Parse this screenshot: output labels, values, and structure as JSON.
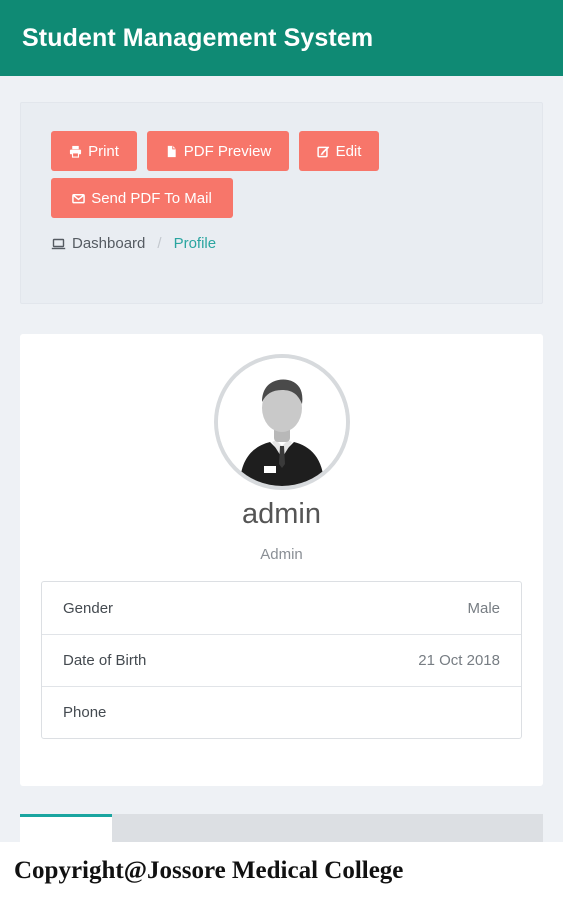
{
  "header": {
    "title": "Student Management System"
  },
  "toolbar": {
    "print_label": "Print",
    "pdf_preview_label": "PDF Preview",
    "edit_label": "Edit",
    "send_mail_label": "Send PDF To Mail"
  },
  "breadcrumb": {
    "home_label": "Dashboard",
    "separator": "/",
    "current_label": "Profile"
  },
  "profile": {
    "name": "admin",
    "role": "Admin",
    "details": [
      {
        "label": "Gender",
        "value": "Male"
      },
      {
        "label": "Date of Birth",
        "value": "21 Oct 2018"
      },
      {
        "label": "Phone",
        "value": ""
      }
    ]
  },
  "footer": {
    "copyright": "Copyright@Jossore Medical College"
  },
  "colors": {
    "header_bg": "#0f8a74",
    "button_bg": "#f7766a",
    "breadcrumb_active": "#2aa5a0",
    "page_bg": "#eef1f5"
  },
  "icons": {
    "print": "print-icon",
    "pdf": "file-icon",
    "edit": "edit-icon",
    "mail": "envelope-icon",
    "dashboard": "laptop-icon",
    "avatar": "user-avatar"
  }
}
